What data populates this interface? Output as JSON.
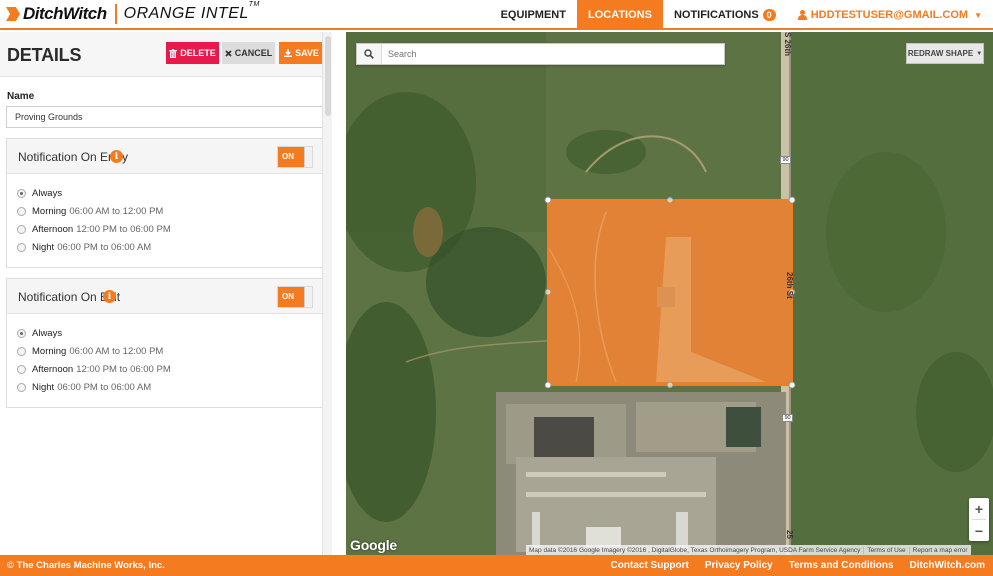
{
  "header": {
    "brand": "DitchWitch",
    "product": "ORANGE INTEL",
    "trademark": "TM",
    "nav": {
      "equipment": "EQUIPMENT",
      "locations": "LOCATIONS",
      "notifications": "NOTIFICATIONS",
      "notifications_count": "0",
      "user": "HDDTESTUSER@GMAIL.COM"
    }
  },
  "details": {
    "title": "DETAILS",
    "delete_label": "DELETE",
    "cancel_label": "CANCEL",
    "save_label": "SAVE",
    "name_label": "Name",
    "name_value": "Proving Grounds",
    "entry": {
      "title": "Notification On Entry",
      "toggle": "ON",
      "options": [
        {
          "name": "Always",
          "time": "",
          "checked": true
        },
        {
          "name": "Morning",
          "time": "06:00 AM to 12:00 PM",
          "checked": false
        },
        {
          "name": "Afternoon",
          "time": "12:00 PM to 06:00 PM",
          "checked": false
        },
        {
          "name": "Night",
          "time": "06:00 PM to 06:00 AM",
          "checked": false
        }
      ]
    },
    "exit": {
      "title": "Notification On Exit",
      "toggle": "ON",
      "options": [
        {
          "name": "Always",
          "time": "",
          "checked": true
        },
        {
          "name": "Morning",
          "time": "06:00 AM to 12:00 PM",
          "checked": false
        },
        {
          "name": "Afternoon",
          "time": "12:00 PM to 06:00 PM",
          "checked": false
        },
        {
          "name": "Night",
          "time": "06:00 PM to 06:00 AM",
          "checked": false
        }
      ]
    }
  },
  "map": {
    "search_placeholder": "Search",
    "redraw_label": "REDRAW SHAPE",
    "zoom_in": "+",
    "zoom_out": "−",
    "google_logo": "Google",
    "attribution": "Map data ©2016 Google Imagery ©2016 , DigitalGlobe, Texas Orthoimagery Program, USDA Farm Service Agency",
    "terms": "Terms of Use",
    "report": "Report a map error",
    "road_labels": [
      "S 26th",
      "26th St",
      "25"
    ],
    "road_shields": [
      "90",
      "90"
    ],
    "geofence_color": "#f47b20"
  },
  "footer": {
    "copyright": "© The Charles Machine Works, Inc.",
    "links": [
      "Contact Support",
      "Privacy Policy",
      "Terms and Conditions",
      "DitchWitch.com"
    ]
  },
  "colors": {
    "accent": "#f47b20",
    "danger": "#e8194b"
  },
  "icons": [
    "trash-icon",
    "close-icon",
    "download-icon",
    "info-icon",
    "search-icon",
    "user-icon",
    "chevron-down-icon"
  ]
}
